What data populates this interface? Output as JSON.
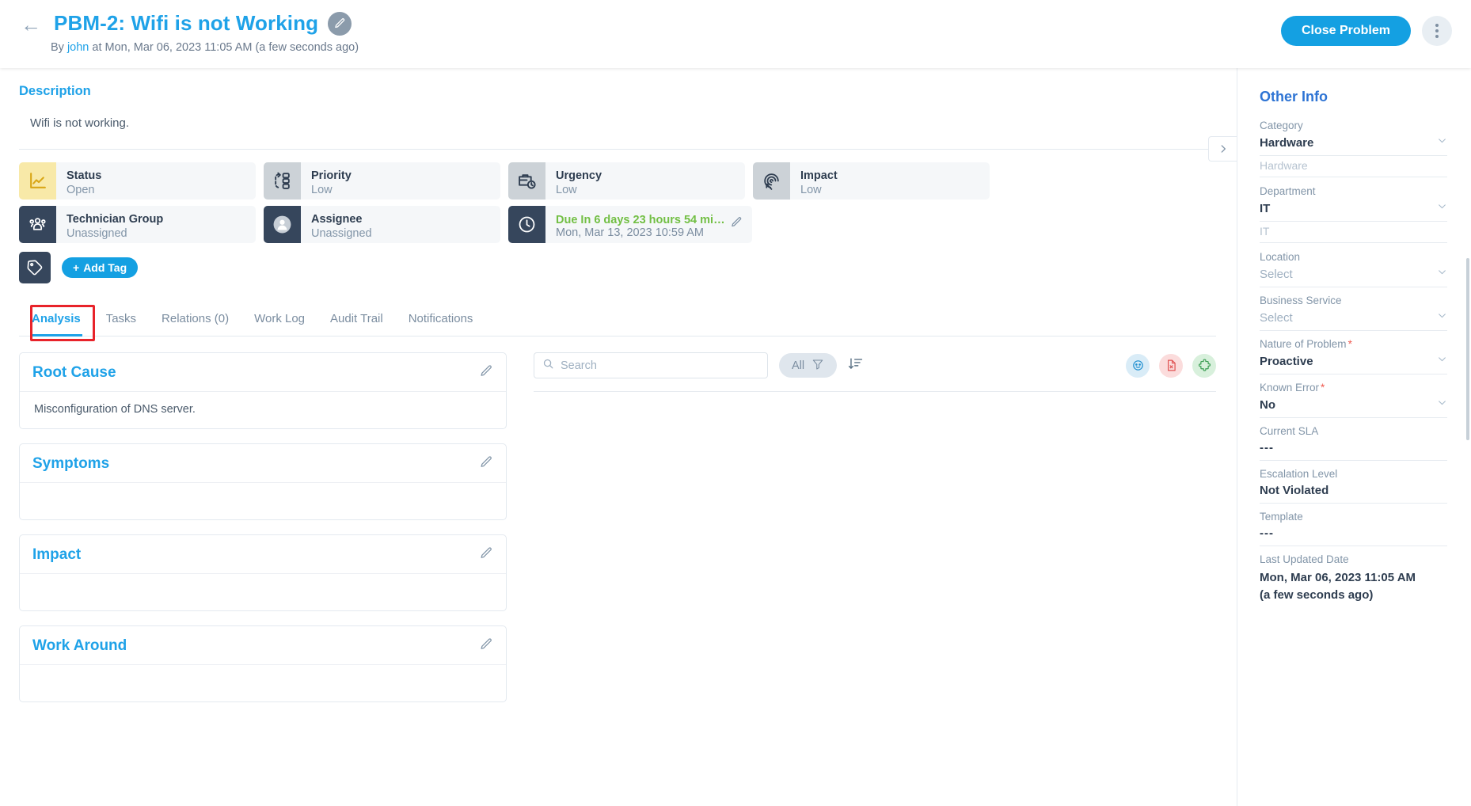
{
  "header": {
    "back_icon": "arrow-left-icon",
    "title": "PBM-2: Wifi is not Working",
    "edit_icon": "pencil-icon",
    "byline_prefix": "By ",
    "byline_user": "john",
    "byline_suffix": " at Mon, Mar 06, 2023 11:05 AM (a few seconds ago)",
    "close_button": "Close Problem",
    "more_icon": "kebab-menu-icon"
  },
  "description": {
    "label": "Description",
    "text": "Wifi is not working."
  },
  "info_cards": [
    {
      "icon": "chart-line-icon",
      "label": "Status",
      "value": "Open",
      "icon_bg": "bg-yellow"
    },
    {
      "icon": "priority-flow-icon",
      "label": "Priority",
      "value": "Low",
      "icon_bg": "bg-grey"
    },
    {
      "icon": "briefcase-clock-icon",
      "label": "Urgency",
      "value": "Low",
      "icon_bg": "bg-grey"
    },
    {
      "icon": "impact-target-icon",
      "label": "Impact",
      "value": "Low",
      "icon_bg": "bg-grey"
    },
    {
      "icon": "users-group-icon",
      "label": "Technician Group",
      "value": "Unassigned",
      "icon_bg": "bg-navy"
    },
    {
      "icon": "user-avatar-icon",
      "label": "Assignee",
      "value": "Unassigned",
      "icon_bg": "bg-navy"
    }
  ],
  "due_card": {
    "icon": "clock-icon",
    "title": "Due In 6 days 23 hours 54 minu…",
    "subtitle": "Mon, Mar 13, 2023 10:59 AM",
    "edit_icon": "pencil-icon"
  },
  "tags": {
    "tag_icon": "tag-icon",
    "add_tag_label": "Add Tag",
    "add_tag_plus": "+"
  },
  "tabs": [
    {
      "label": "Analysis",
      "active": true
    },
    {
      "label": "Tasks",
      "active": false
    },
    {
      "label": "Relations (0)",
      "active": false
    },
    {
      "label": "Work Log",
      "active": false
    },
    {
      "label": "Audit Trail",
      "active": false
    },
    {
      "label": "Notifications",
      "active": false
    }
  ],
  "analysis_panels": [
    {
      "title": "Root Cause",
      "body": "Misconfiguration of DNS server.",
      "edit_icon": "pencil-icon"
    },
    {
      "title": "Symptoms",
      "body": "",
      "edit_icon": "pencil-icon"
    },
    {
      "title": "Impact",
      "body": "",
      "edit_icon": "pencil-icon"
    },
    {
      "title": "Work Around",
      "body": "",
      "edit_icon": "pencil-icon"
    }
  ],
  "toolbar": {
    "search_placeholder": "Search",
    "search_value": "",
    "search_icon": "search-icon",
    "filter_label": "All",
    "filter_icon": "funnel-icon",
    "sort_icon": "sort-descending-icon",
    "actions": [
      {
        "icon": "smiley-note-icon",
        "style": "rb-blue"
      },
      {
        "icon": "pdf-file-icon",
        "style": "rb-red"
      },
      {
        "icon": "puzzle-piece-icon",
        "style": "rb-green"
      }
    ]
  },
  "collapse_toggle": {
    "icon": "chevron-right-icon"
  },
  "sidebar": {
    "title": "Other Info",
    "fields": [
      {
        "label": "Category",
        "value": "Hardware",
        "type": "select",
        "sub": "Hardware",
        "required": false
      },
      {
        "label": "Department",
        "value": "IT",
        "type": "select",
        "sub": "IT",
        "required": false
      },
      {
        "label": "Location",
        "value": "Select",
        "type": "select",
        "muted": true,
        "required": false
      },
      {
        "label": "Business Service",
        "value": "Select",
        "type": "select",
        "muted": true,
        "required": false
      },
      {
        "label": "Nature of Problem",
        "value": "Proactive",
        "type": "select",
        "required": true
      },
      {
        "label": "Known Error",
        "value": "No",
        "type": "select",
        "required": true
      },
      {
        "label": "Current SLA",
        "value": "---",
        "type": "text",
        "required": false
      },
      {
        "label": "Escalation Level",
        "value": "Not Violated",
        "type": "text",
        "required": false
      },
      {
        "label": "Template",
        "value": "---",
        "type": "text",
        "required": false
      }
    ],
    "last_updated": {
      "label": "Last Updated Date",
      "line1": "Mon, Mar 06, 2023 11:05 AM",
      "line2": "(a few seconds ago)"
    }
  },
  "colors": {
    "accent_blue": "#14a0e2",
    "link_blue": "#1fa2e8",
    "sidebar_title_blue": "#2e74d4",
    "green_due": "#72bf44",
    "navy": "#36465c",
    "yellow": "#f8e9a8",
    "grey_icon": "#ccd2d7",
    "required_red": "#ef5b51",
    "highlight_red": "#e8232a"
  }
}
